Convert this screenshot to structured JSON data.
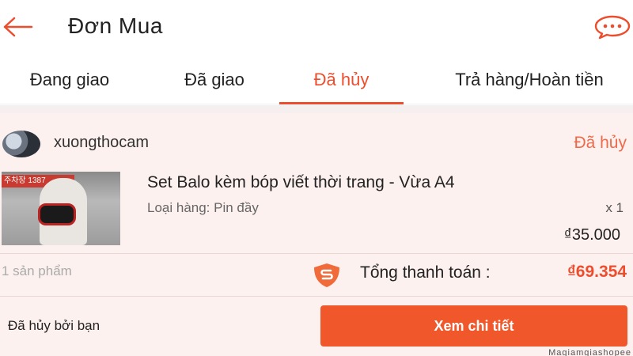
{
  "header": {
    "title": "Đơn Mua",
    "back_icon": "arrow-left-icon",
    "chat_icon": "chat-bubble-icon"
  },
  "tabs": [
    {
      "label": "Đang giao",
      "active": false
    },
    {
      "label": "Đã giao",
      "active": false
    },
    {
      "label": "Đã hủy",
      "active": true
    },
    {
      "label": "Trả hàng/Hoàn tiền",
      "active": false
    }
  ],
  "order": {
    "shop_name": "xuongthocam",
    "status": "Đã hủy",
    "product": {
      "name": "Set Balo kèm bóp viết thời trang - Vừa A4",
      "variant": "Loại hàng: Pin đầy",
      "quantity": "x 1",
      "price": "₫35.000",
      "thumb_sign": "주차장 1387"
    },
    "item_count": "1 sản phẩm",
    "total_label": "Tổng thanh toán :",
    "total_value": "₫69.354",
    "cancel_note": "Đã hủy bởi bạn",
    "detail_button": "Xem chi tiết"
  },
  "watermark": "Magiamgiashopee",
  "colors": {
    "accent": "#ee4d2d",
    "button": "#f0582c",
    "card_bg": "#fdf1ef"
  }
}
